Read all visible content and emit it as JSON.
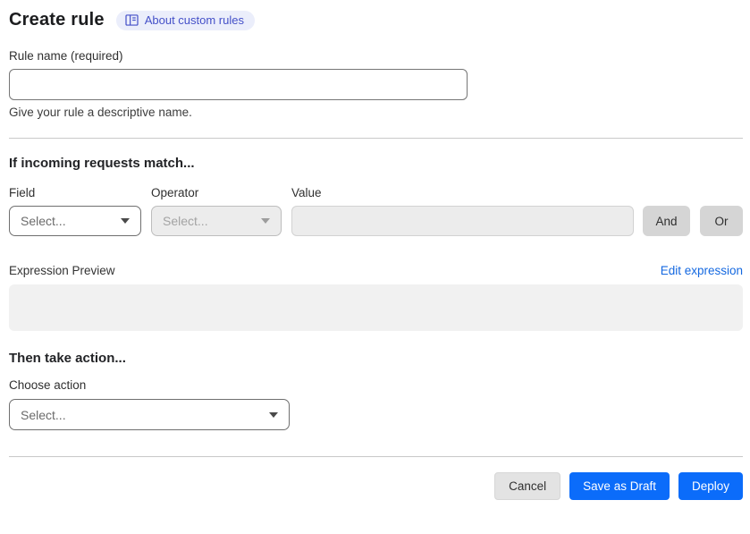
{
  "header": {
    "title": "Create rule",
    "about_badge": "About custom rules"
  },
  "rule_name": {
    "label": "Rule name (required)",
    "value": "",
    "placeholder": "",
    "help": "Give your rule a descriptive name."
  },
  "match_section": {
    "heading": "If incoming requests match...",
    "field_label": "Field",
    "field_value": "Select...",
    "operator_label": "Operator",
    "operator_value": "Select...",
    "value_label": "Value",
    "value_value": "",
    "and_label": "And",
    "or_label": "Or"
  },
  "expression": {
    "label": "Expression Preview",
    "edit_link": "Edit expression",
    "content": ""
  },
  "action_section": {
    "heading": "Then take action...",
    "choose_label": "Choose action",
    "select_value": "Select..."
  },
  "footer": {
    "cancel": "Cancel",
    "save_draft": "Save as Draft",
    "deploy": "Deploy"
  },
  "colors": {
    "primary_blue": "#0b6cfa",
    "link_blue": "#1468e0",
    "badge_bg": "#ebeefb",
    "badge_text": "#4450c8",
    "disabled_bg": "#ececec",
    "chip_gray": "#d5d5d5"
  }
}
